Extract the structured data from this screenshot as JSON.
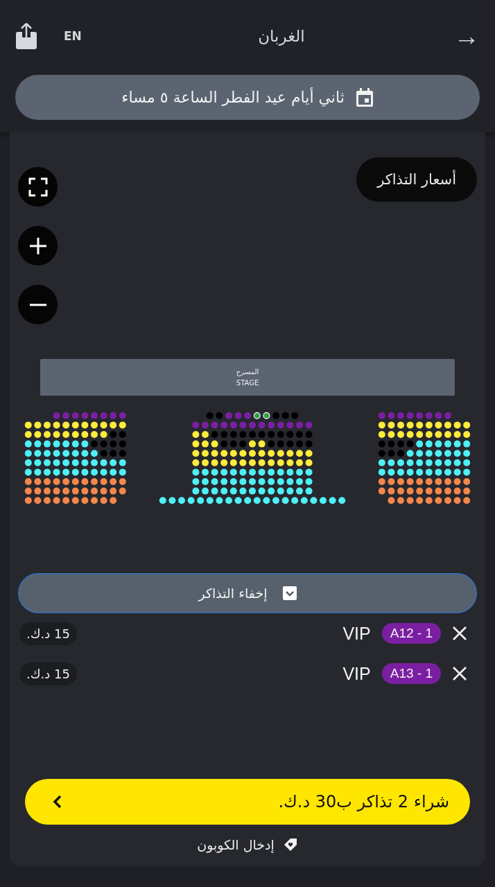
{
  "header": {
    "back_icon": "→",
    "title": "الغربان",
    "language": "EN"
  },
  "date_selector": {
    "label": "ثاني أيام عيد الفطر الساعة ٥ مساء"
  },
  "prices_button": {
    "label": "أسعار التذاكر"
  },
  "stage": {
    "label_ar": "المسرح",
    "label_en": "STAGE"
  },
  "seat_sections": [
    {
      "rows": [
        {
          "kind": "right",
          "seats": [
            {
              "color": "#7b1fa2",
              "selected": false
            },
            {
              "color": "#7b1fa2",
              "selected": false
            },
            {
              "color": "#7b1fa2",
              "selected": false
            },
            {
              "color": "#7b1fa2",
              "selected": false
            },
            {
              "color": "#7b1fa2",
              "selected": false
            },
            {
              "color": "#7b1fa2",
              "selected": false
            },
            {
              "color": "#7b1fa2",
              "selected": false
            },
            {
              "color": "#7b1fa2",
              "selected": false
            }
          ]
        },
        {
          "seats": [
            {
              "color": "#ffeb3b",
              "selected": false
            },
            {
              "color": "#ffeb3b",
              "selected": false
            },
            {
              "color": "#ffeb3b",
              "selected": false
            },
            {
              "color": "#ffeb3b",
              "selected": false
            },
            {
              "color": "#ffeb3b",
              "selected": false
            },
            {
              "color": "#ffeb3b",
              "selected": false
            },
            {
              "color": "#ffeb3b",
              "selected": false
            },
            {
              "color": "#ffeb3b",
              "selected": false
            },
            {
              "color": "#ffeb3b",
              "selected": false
            },
            {
              "color": "#ffeb3b",
              "selected": false
            },
            {
              "color": "#ffeb3b",
              "selected": false
            }
          ]
        },
        {
          "seats": [
            {
              "color": "#ffeb3b",
              "selected": false
            },
            {
              "color": "#ffeb3b",
              "selected": false
            },
            {
              "color": "#ffeb3b",
              "selected": false
            },
            {
              "color": "#ffeb3b",
              "selected": false
            },
            {
              "color": "#ffeb3b",
              "selected": false
            },
            {
              "color": "#ffeb3b",
              "selected": false
            },
            {
              "color": "#ffeb3b",
              "selected": false
            },
            {
              "color": "#ffeb3b",
              "selected": false
            },
            {
              "color": "#ffeb3b",
              "selected": false
            },
            {
              "color": "#000000",
              "selected": false
            },
            {
              "color": "#000000",
              "selected": false
            }
          ]
        },
        {
          "seats": [
            {
              "color": "#4ff0f5",
              "selected": false
            },
            {
              "color": "#4ff0f5",
              "selected": false
            },
            {
              "color": "#4ff0f5",
              "selected": false
            },
            {
              "color": "#4ff0f5",
              "selected": false
            },
            {
              "color": "#4ff0f5",
              "selected": false
            },
            {
              "color": "#4ff0f5",
              "selected": false
            },
            {
              "color": "#4ff0f5",
              "selected": false
            },
            {
              "color": "#000000",
              "selected": false
            },
            {
              "color": "#000000",
              "selected": false
            },
            {
              "color": "#000000",
              "selected": false
            },
            {
              "color": "#000000",
              "selected": false
            }
          ]
        },
        {
          "seats": [
            {
              "color": "#4ff0f5",
              "selected": false
            },
            {
              "color": "#4ff0f5",
              "selected": false
            },
            {
              "color": "#4ff0f5",
              "selected": false
            },
            {
              "color": "#4ff0f5",
              "selected": false
            },
            {
              "color": "#4ff0f5",
              "selected": false
            },
            {
              "color": "#4ff0f5",
              "selected": false
            },
            {
              "color": "#4ff0f5",
              "selected": false
            },
            {
              "color": "#4ff0f5",
              "selected": false
            },
            {
              "color": "#000000",
              "selected": false
            },
            {
              "color": "#000000",
              "selected": false
            },
            {
              "color": "#000000",
              "selected": false
            }
          ]
        },
        {
          "seats": [
            {
              "color": "#4ff0f5",
              "selected": false
            },
            {
              "color": "#4ff0f5",
              "selected": false
            },
            {
              "color": "#4ff0f5",
              "selected": false
            },
            {
              "color": "#4ff0f5",
              "selected": false
            },
            {
              "color": "#4ff0f5",
              "selected": false
            },
            {
              "color": "#4ff0f5",
              "selected": false
            },
            {
              "color": "#4ff0f5",
              "selected": false
            },
            {
              "color": "#4ff0f5",
              "selected": false
            },
            {
              "color": "#4ff0f5",
              "selected": false
            },
            {
              "color": "#4ff0f5",
              "selected": false
            },
            {
              "color": "#4ff0f5",
              "selected": false
            }
          ]
        },
        {
          "seats": [
            {
              "color": "#4ff0f5",
              "selected": false
            },
            {
              "color": "#4ff0f5",
              "selected": false
            },
            {
              "color": "#4ff0f5",
              "selected": false
            },
            {
              "color": "#4ff0f5",
              "selected": false
            },
            {
              "color": "#4ff0f5",
              "selected": false
            },
            {
              "color": "#4ff0f5",
              "selected": false
            },
            {
              "color": "#4ff0f5",
              "selected": false
            },
            {
              "color": "#4ff0f5",
              "selected": false
            },
            {
              "color": "#4ff0f5",
              "selected": false
            },
            {
              "color": "#4ff0f5",
              "selected": false
            },
            {
              "color": "#4ff0f5",
              "selected": false
            }
          ]
        },
        {
          "seats": [
            {
              "color": "#f4874b",
              "selected": false
            },
            {
              "color": "#f4874b",
              "selected": false
            },
            {
              "color": "#f4874b",
              "selected": false
            },
            {
              "color": "#f4874b",
              "selected": false
            },
            {
              "color": "#f4874b",
              "selected": false
            },
            {
              "color": "#f4874b",
              "selected": false
            },
            {
              "color": "#f4874b",
              "selected": false
            },
            {
              "color": "#f4874b",
              "selected": false
            },
            {
              "color": "#f4874b",
              "selected": false
            },
            {
              "color": "#f4874b",
              "selected": false
            },
            {
              "color": "#f4874b",
              "selected": false
            }
          ]
        },
        {
          "seats": [
            {
              "color": "#f4874b",
              "selected": false
            },
            {
              "color": "#f4874b",
              "selected": false
            },
            {
              "color": "#f4874b",
              "selected": false
            },
            {
              "color": "#f4874b",
              "selected": false
            },
            {
              "color": "#f4874b",
              "selected": false
            },
            {
              "color": "#f4874b",
              "selected": false
            },
            {
              "color": "#f4874b",
              "selected": false
            },
            {
              "color": "#f4874b",
              "selected": false
            },
            {
              "color": "#f4874b",
              "selected": false
            },
            {
              "color": "#f4874b",
              "selected": false
            },
            {
              "color": "#f4874b",
              "selected": false
            }
          ]
        },
        {
          "kind": "left",
          "seats": [
            {
              "color": "#f4874b",
              "selected": false
            },
            {
              "color": "#f4874b",
              "selected": false
            },
            {
              "color": "#f4874b",
              "selected": false
            },
            {
              "color": "#f4874b",
              "selected": false
            },
            {
              "color": "#f4874b",
              "selected": false
            },
            {
              "color": "#f4874b",
              "selected": false
            },
            {
              "color": "#f4874b",
              "selected": false
            },
            {
              "color": "#f4874b",
              "selected": false
            },
            {
              "color": "#f4874b",
              "selected": false
            },
            {
              "color": "#f4874b",
              "selected": false
            }
          ]
        }
      ]
    },
    {
      "rows": [
        {
          "seats": [
            {
              "color": "#000000",
              "selected": false
            },
            {
              "color": "#000000",
              "selected": false
            },
            {
              "color": "#7b1fa2",
              "selected": false
            },
            {
              "color": "#7b1fa2",
              "selected": false
            },
            {
              "color": "#7b1fa2",
              "selected": false
            },
            {
              "color": "#2e9d4a",
              "selected": true
            },
            {
              "color": "#2e9d4a",
              "selected": true
            },
            {
              "color": "#000000",
              "selected": false
            },
            {
              "color": "#000000",
              "selected": false
            },
            {
              "color": "#000000",
              "selected": false
            }
          ]
        },
        {
          "seats": [
            {
              "color": "#7b1fa2",
              "selected": false
            },
            {
              "color": "#7b1fa2",
              "selected": false
            },
            {
              "color": "#7b1fa2",
              "selected": false
            },
            {
              "color": "#7b1fa2",
              "selected": false
            },
            {
              "color": "#7b1fa2",
              "selected": false
            },
            {
              "color": "#7b1fa2",
              "selected": false
            },
            {
              "color": "#7b1fa2",
              "selected": false
            },
            {
              "color": "#7b1fa2",
              "selected": false
            },
            {
              "color": "#7b1fa2",
              "selected": false
            },
            {
              "color": "#7b1fa2",
              "selected": false
            },
            {
              "color": "#7b1fa2",
              "selected": false
            },
            {
              "color": "#7b1fa2",
              "selected": false
            },
            {
              "color": "#7b1fa2",
              "selected": false
            }
          ]
        },
        {
          "seats": [
            {
              "color": "#ffeb3b",
              "selected": false
            },
            {
              "color": "#ffeb3b",
              "selected": false
            },
            {
              "color": "#000000",
              "selected": false
            },
            {
              "color": "#000000",
              "selected": false
            },
            {
              "color": "#000000",
              "selected": false
            },
            {
              "color": "#000000",
              "selected": false
            },
            {
              "color": "#000000",
              "selected": false
            },
            {
              "color": "#000000",
              "selected": false
            },
            {
              "color": "#000000",
              "selected": false
            },
            {
              "color": "#000000",
              "selected": false
            },
            {
              "color": "#000000",
              "selected": false
            },
            {
              "color": "#000000",
              "selected": false
            },
            {
              "color": "#000000",
              "selected": false
            }
          ]
        },
        {
          "seats": [
            {
              "color": "#ffeb3b",
              "selected": false
            },
            {
              "color": "#ffeb3b",
              "selected": false
            },
            {
              "color": "#ffeb3b",
              "selected": false
            },
            {
              "color": "#000000",
              "selected": false
            },
            {
              "color": "#000000",
              "selected": false
            },
            {
              "color": "#000000",
              "selected": false
            },
            {
              "color": "#ffeb3b",
              "selected": false
            },
            {
              "color": "#ffeb3b",
              "selected": false
            },
            {
              "color": "#000000",
              "selected": false
            },
            {
              "color": "#000000",
              "selected": false
            },
            {
              "color": "#000000",
              "selected": false
            },
            {
              "color": "#000000",
              "selected": false
            },
            {
              "color": "#000000",
              "selected": false
            }
          ]
        },
        {
          "seats": [
            {
              "color": "#ffeb3b",
              "selected": false
            },
            {
              "color": "#ffeb3b",
              "selected": false
            },
            {
              "color": "#ffeb3b",
              "selected": false
            },
            {
              "color": "#ffeb3b",
              "selected": false
            },
            {
              "color": "#ffeb3b",
              "selected": false
            },
            {
              "color": "#ffeb3b",
              "selected": false
            },
            {
              "color": "#ffeb3b",
              "selected": false
            },
            {
              "color": "#ffeb3b",
              "selected": false
            },
            {
              "color": "#ffeb3b",
              "selected": false
            },
            {
              "color": "#ffeb3b",
              "selected": false
            },
            {
              "color": "#ffeb3b",
              "selected": false
            },
            {
              "color": "#ffeb3b",
              "selected": false
            },
            {
              "color": "#ffeb3b",
              "selected": false
            }
          ]
        },
        {
          "seats": [
            {
              "color": "#ffeb3b",
              "selected": false
            },
            {
              "color": "#ffeb3b",
              "selected": false
            },
            {
              "color": "#ffeb3b",
              "selected": false
            },
            {
              "color": "#ffeb3b",
              "selected": false
            },
            {
              "color": "#ffeb3b",
              "selected": false
            },
            {
              "color": "#ffeb3b",
              "selected": false
            },
            {
              "color": "#ffeb3b",
              "selected": false
            },
            {
              "color": "#ffeb3b",
              "selected": false
            },
            {
              "color": "#ffeb3b",
              "selected": false
            },
            {
              "color": "#ffeb3b",
              "selected": false
            },
            {
              "color": "#ffeb3b",
              "selected": false
            },
            {
              "color": "#ffeb3b",
              "selected": false
            },
            {
              "color": "#ffeb3b",
              "selected": false
            }
          ]
        },
        {
          "seats": [
            {
              "color": "#4ff0f5",
              "selected": false
            },
            {
              "color": "#4ff0f5",
              "selected": false
            },
            {
              "color": "#4ff0f5",
              "selected": false
            },
            {
              "color": "#4ff0f5",
              "selected": false
            },
            {
              "color": "#4ff0f5",
              "selected": false
            },
            {
              "color": "#4ff0f5",
              "selected": false
            },
            {
              "color": "#4ff0f5",
              "selected": false
            },
            {
              "color": "#4ff0f5",
              "selected": false
            },
            {
              "color": "#4ff0f5",
              "selected": false
            },
            {
              "color": "#4ff0f5",
              "selected": false
            },
            {
              "color": "#4ff0f5",
              "selected": false
            },
            {
              "color": "#4ff0f5",
              "selected": false
            },
            {
              "color": "#4ff0f5",
              "selected": false
            }
          ]
        },
        {
          "seats": [
            {
              "color": "#4ff0f5",
              "selected": false
            },
            {
              "color": "#4ff0f5",
              "selected": false
            },
            {
              "color": "#4ff0f5",
              "selected": false
            },
            {
              "color": "#4ff0f5",
              "selected": false
            },
            {
              "color": "#4ff0f5",
              "selected": false
            },
            {
              "color": "#4ff0f5",
              "selected": false
            },
            {
              "color": "#4ff0f5",
              "selected": false
            },
            {
              "color": "#4ff0f5",
              "selected": false
            },
            {
              "color": "#4ff0f5",
              "selected": false
            },
            {
              "color": "#4ff0f5",
              "selected": false
            },
            {
              "color": "#4ff0f5",
              "selected": false
            },
            {
              "color": "#4ff0f5",
              "selected": false
            },
            {
              "color": "#4ff0f5",
              "selected": false
            }
          ]
        },
        {
          "seats": [
            {
              "color": "#4ff0f5",
              "selected": false
            },
            {
              "color": "#4ff0f5",
              "selected": false
            },
            {
              "color": "#4ff0f5",
              "selected": false
            },
            {
              "color": "#4ff0f5",
              "selected": false
            },
            {
              "color": "#4ff0f5",
              "selected": false
            },
            {
              "color": "#4ff0f5",
              "selected": false
            },
            {
              "color": "#4ff0f5",
              "selected": false
            },
            {
              "color": "#4ff0f5",
              "selected": false
            },
            {
              "color": "#4ff0f5",
              "selected": false
            },
            {
              "color": "#4ff0f5",
              "selected": false
            },
            {
              "color": "#4ff0f5",
              "selected": false
            },
            {
              "color": "#4ff0f5",
              "selected": false
            },
            {
              "color": "#4ff0f5",
              "selected": false
            }
          ]
        },
        {
          "seats": [
            {
              "color": "#4ff0f5",
              "selected": false
            },
            {
              "color": "#4ff0f5",
              "selected": false
            },
            {
              "color": "#4ff0f5",
              "selected": false
            },
            {
              "color": "#4ff0f5",
              "selected": false
            },
            {
              "color": "#4ff0f5",
              "selected": false
            },
            {
              "color": "#4ff0f5",
              "selected": false
            },
            {
              "color": "#4ff0f5",
              "selected": false
            },
            {
              "color": "#4ff0f5",
              "selected": false
            },
            {
              "color": "#4ff0f5",
              "selected": false
            },
            {
              "color": "#4ff0f5",
              "selected": false
            },
            {
              "color": "#4ff0f5",
              "selected": false
            },
            {
              "color": "#4ff0f5",
              "selected": false
            },
            {
              "color": "#4ff0f5",
              "selected": false
            },
            {
              "color": "#4ff0f5",
              "selected": false
            },
            {
              "color": "#4ff0f5",
              "selected": false
            },
            {
              "color": "#4ff0f5",
              "selected": false
            },
            {
              "color": "#4ff0f5",
              "selected": false
            },
            {
              "color": "#4ff0f5",
              "selected": false
            },
            {
              "color": "#4ff0f5",
              "selected": false
            },
            {
              "color": "#4ff0f5",
              "selected": false
            }
          ]
        }
      ]
    },
    {
      "rows": [
        {
          "kind": "left",
          "seats": [
            {
              "color": "#7b1fa2",
              "selected": false
            },
            {
              "color": "#7b1fa2",
              "selected": false
            },
            {
              "color": "#7b1fa2",
              "selected": false
            },
            {
              "color": "#7b1fa2",
              "selected": false
            },
            {
              "color": "#7b1fa2",
              "selected": false
            },
            {
              "color": "#7b1fa2",
              "selected": false
            },
            {
              "color": "#7b1fa2",
              "selected": false
            },
            {
              "color": "#7b1fa2",
              "selected": false
            }
          ]
        },
        {
          "seats": [
            {
              "color": "#ffeb3b",
              "selected": false
            },
            {
              "color": "#ffeb3b",
              "selected": false
            },
            {
              "color": "#ffeb3b",
              "selected": false
            },
            {
              "color": "#ffeb3b",
              "selected": false
            },
            {
              "color": "#ffeb3b",
              "selected": false
            },
            {
              "color": "#ffeb3b",
              "selected": false
            },
            {
              "color": "#ffeb3b",
              "selected": false
            },
            {
              "color": "#ffeb3b",
              "selected": false
            },
            {
              "color": "#ffeb3b",
              "selected": false
            },
            {
              "color": "#ffeb3b",
              "selected": false
            }
          ]
        },
        {
          "seats": [
            {
              "color": "#ffeb3b",
              "selected": false
            },
            {
              "color": "#ffeb3b",
              "selected": false
            },
            {
              "color": "#ffeb3b",
              "selected": false
            },
            {
              "color": "#ffeb3b",
              "selected": false
            },
            {
              "color": "#ffeb3b",
              "selected": false
            },
            {
              "color": "#ffeb3b",
              "selected": false
            },
            {
              "color": "#ffeb3b",
              "selected": false
            },
            {
              "color": "#ffeb3b",
              "selected": false
            },
            {
              "color": "#ffeb3b",
              "selected": false
            },
            {
              "color": "#ffeb3b",
              "selected": false
            }
          ]
        },
        {
          "seats": [
            {
              "color": "#000000",
              "selected": false
            },
            {
              "color": "#000000",
              "selected": false
            },
            {
              "color": "#000000",
              "selected": false
            },
            {
              "color": "#000000",
              "selected": false
            },
            {
              "color": "#4ff0f5",
              "selected": false
            },
            {
              "color": "#4ff0f5",
              "selected": false
            },
            {
              "color": "#4ff0f5",
              "selected": false
            },
            {
              "color": "#4ff0f5",
              "selected": false
            },
            {
              "color": "#4ff0f5",
              "selected": false
            },
            {
              "color": "#4ff0f5",
              "selected": false
            }
          ]
        },
        {
          "seats": [
            {
              "color": "#000000",
              "selected": false
            },
            {
              "color": "#000000",
              "selected": false
            },
            {
              "color": "#000000",
              "selected": false
            },
            {
              "color": "#4ff0f5",
              "selected": false
            },
            {
              "color": "#4ff0f5",
              "selected": false
            },
            {
              "color": "#4ff0f5",
              "selected": false
            },
            {
              "color": "#4ff0f5",
              "selected": false
            },
            {
              "color": "#4ff0f5",
              "selected": false
            },
            {
              "color": "#4ff0f5",
              "selected": false
            },
            {
              "color": "#4ff0f5",
              "selected": false
            }
          ]
        },
        {
          "seats": [
            {
              "color": "#4ff0f5",
              "selected": false
            },
            {
              "color": "#4ff0f5",
              "selected": false
            },
            {
              "color": "#4ff0f5",
              "selected": false
            },
            {
              "color": "#4ff0f5",
              "selected": false
            },
            {
              "color": "#4ff0f5",
              "selected": false
            },
            {
              "color": "#4ff0f5",
              "selected": false
            },
            {
              "color": "#4ff0f5",
              "selected": false
            },
            {
              "color": "#4ff0f5",
              "selected": false
            },
            {
              "color": "#4ff0f5",
              "selected": false
            },
            {
              "color": "#4ff0f5",
              "selected": false
            }
          ]
        },
        {
          "seats": [
            {
              "color": "#4ff0f5",
              "selected": false
            },
            {
              "color": "#4ff0f5",
              "selected": false
            },
            {
              "color": "#4ff0f5",
              "selected": false
            },
            {
              "color": "#4ff0f5",
              "selected": false
            },
            {
              "color": "#4ff0f5",
              "selected": false
            },
            {
              "color": "#4ff0f5",
              "selected": false
            },
            {
              "color": "#4ff0f5",
              "selected": false
            },
            {
              "color": "#4ff0f5",
              "selected": false
            },
            {
              "color": "#4ff0f5",
              "selected": false
            },
            {
              "color": "#4ff0f5",
              "selected": false
            }
          ]
        },
        {
          "seats": [
            {
              "color": "#f4874b",
              "selected": false
            },
            {
              "color": "#f4874b",
              "selected": false
            },
            {
              "color": "#f4874b",
              "selected": false
            },
            {
              "color": "#f4874b",
              "selected": false
            },
            {
              "color": "#f4874b",
              "selected": false
            },
            {
              "color": "#f4874b",
              "selected": false
            },
            {
              "color": "#f4874b",
              "selected": false
            },
            {
              "color": "#f4874b",
              "selected": false
            },
            {
              "color": "#f4874b",
              "selected": false
            },
            {
              "color": "#f4874b",
              "selected": false
            }
          ]
        },
        {
          "seats": [
            {
              "color": "#f4874b",
              "selected": false
            },
            {
              "color": "#f4874b",
              "selected": false
            },
            {
              "color": "#f4874b",
              "selected": false
            },
            {
              "color": "#f4874b",
              "selected": false
            },
            {
              "color": "#f4874b",
              "selected": false
            },
            {
              "color": "#f4874b",
              "selected": false
            },
            {
              "color": "#f4874b",
              "selected": false
            },
            {
              "color": "#f4874b",
              "selected": false
            },
            {
              "color": "#f4874b",
              "selected": false
            },
            {
              "color": "#f4874b",
              "selected": false
            }
          ]
        },
        {
          "kind": "right",
          "seats": [
            {
              "color": "#f4874b",
              "selected": false
            },
            {
              "color": "#f4874b",
              "selected": false
            },
            {
              "color": "#f4874b",
              "selected": false
            },
            {
              "color": "#f4874b",
              "selected": false
            },
            {
              "color": "#f4874b",
              "selected": false
            },
            {
              "color": "#f4874b",
              "selected": false
            },
            {
              "color": "#f4874b",
              "selected": false
            },
            {
              "color": "#f4874b",
              "selected": false
            },
            {
              "color": "#f4874b",
              "selected": false
            }
          ]
        }
      ]
    }
  ],
  "tickets_toggle": {
    "label": "إخفاء التذاكر",
    "expanded": true
  },
  "tickets": [
    {
      "seat": "A12 - 1",
      "category": "VIP",
      "price": "15 د.ك."
    },
    {
      "seat": "A13 - 1",
      "category": "VIP",
      "price": "15 د.ك."
    }
  ],
  "buy_button": {
    "label": "شراء 2 تذاكر ب30 د.ك."
  },
  "coupon_link": {
    "label": "إدخال الكوبون"
  }
}
